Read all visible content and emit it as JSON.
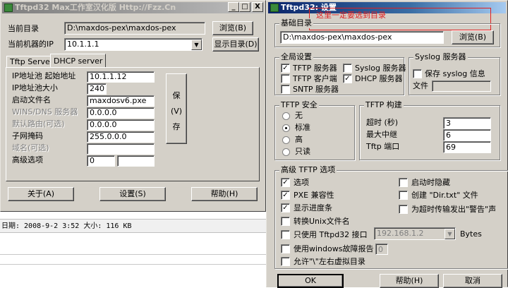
{
  "left_window": {
    "title": "Tftpd32 Max工作室汉化版 Http://Fzz.Cn",
    "title_buttons": [
      "_",
      "□",
      "X"
    ],
    "current_dir_label": "当前目录",
    "current_dir_value": "D:\\maxdos-pex\\maxdos-pex",
    "browse_button": "浏览(B)",
    "ip_label": "当前机器的IP",
    "ip_value": "10.1.1.1",
    "show_dir_button": "显示目录(D)",
    "tabs": [
      "Tftp Server",
      "DHCP server"
    ],
    "dhcp": {
      "fields": [
        {
          "label": "IP地址池 起始地址",
          "value": "10.1.1.12",
          "disabled": false
        },
        {
          "label": "IP地址池大小",
          "value": "240",
          "disabled": false
        },
        {
          "label": "启动文件名",
          "value": "maxdosv6.pxe",
          "disabled": false
        },
        {
          "label": "WINS/DNS 服务器",
          "value": "0.0.0.0",
          "disabled": true
        },
        {
          "label": "默认路由(可选)",
          "value": "0.0.0.0",
          "disabled": true
        },
        {
          "label": "子网掩码",
          "value": "255.0.0.0",
          "disabled": false
        },
        {
          "label": "域名(可选)",
          "value": "",
          "disabled": true
        },
        {
          "label": "高级选项",
          "value": "0",
          "disabled": false
        }
      ],
      "save_button_lines": [
        "保",
        "(V)",
        "存"
      ]
    },
    "about_button": "关于(A)",
    "settings_button": "设置(S)",
    "help_button": "帮助(H)"
  },
  "log_line": "日期: 2008-9-2 3:52 大小: 116 KB",
  "settings_dialog": {
    "title": "Tftpd32: 设置",
    "annotation": "这里一定要选到目录",
    "annotation_color": "#e02020",
    "basic_dir_group": "基础目录",
    "basic_dir_value": "D:\\maxdos-pex\\maxdos-pex",
    "browse_button": "浏览(B)",
    "global_group": "全局设置",
    "global_items": [
      {
        "label": "TFTP 服务器",
        "checked": true
      },
      {
        "label": "Syslog 服务器",
        "checked": false
      },
      {
        "label": "TFTP 客户端",
        "checked": false
      },
      {
        "label": "DHCP 服务器",
        "checked": true
      },
      {
        "label": "SNTP 服务器",
        "checked": false
      }
    ],
    "syslog_group": "Syslog 服务器",
    "syslog_save_label": "保存 syslog 信息",
    "syslog_file_label": "文件",
    "tftp_security_group": "TFTP 安全",
    "security_options": [
      {
        "label": "无",
        "selected": false
      },
      {
        "label": "标准",
        "selected": true
      },
      {
        "label": "高",
        "selected": false
      },
      {
        "label": "只读",
        "selected": false
      }
    ],
    "tftp_config_group": "TFTP 构建",
    "config_fields": [
      {
        "label": "超时 (秒)",
        "value": "3"
      },
      {
        "label": "最大中继",
        "value": "6"
      },
      {
        "label": "Tftp 端口",
        "value": "69"
      }
    ],
    "advanced_group": "高级 TFTP 选项",
    "advanced_left": [
      {
        "label": "选项",
        "checked": true
      },
      {
        "label": "PXE 兼容性",
        "checked": true
      },
      {
        "label": "显示进度条",
        "checked": true
      },
      {
        "label": "转换Unix文件名",
        "checked": false
      },
      {
        "label": "只使用  Tftpd32 接口",
        "checked": false
      },
      {
        "label": "使用windows故障报告",
        "checked": false
      },
      {
        "label": "允许\"\\\"左右虚拟目录",
        "checked": false
      }
    ],
    "advanced_right": [
      {
        "label": "启动时隐藏",
        "checked": false
      },
      {
        "label": "创建 \"Dir.txt\" 文件",
        "checked": false
      },
      {
        "label": "为超时传输发出\"警告\"声",
        "checked": false
      }
    ],
    "interface_ip": "192.168.1.2",
    "bytes_label": "Bytes",
    "error_report_value": "0",
    "ok_button": "OK",
    "help_button": "帮助(H)",
    "cancel_button": "取消"
  }
}
